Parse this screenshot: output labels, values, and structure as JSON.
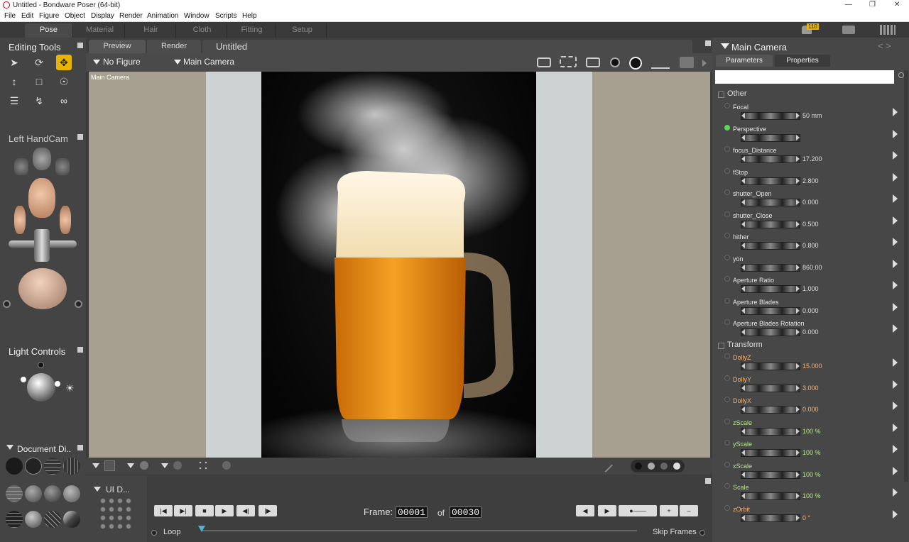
{
  "window": {
    "title": "Untitled - Bondware Poser (64-bit)"
  },
  "menu": [
    "File",
    "Edit",
    "Figure",
    "Object",
    "Display",
    "Render",
    "Animation",
    "Window",
    "Scripts",
    "Help"
  ],
  "rooms": [
    "Pose",
    "Material",
    "Hair",
    "Cloth",
    "Fitting",
    "Setup"
  ],
  "active_room": "Pose",
  "header_badge": "110",
  "editing_tools": {
    "title": "Editing Tools"
  },
  "handcam": {
    "title": "Left HandCam"
  },
  "light_controls": {
    "title": "Light Controls"
  },
  "document_display": {
    "title": "Document Di.."
  },
  "ui_dots": {
    "title": "UI D..."
  },
  "doc_tabs": {
    "preview": "Preview",
    "render": "Render",
    "doc_title": "Untitled"
  },
  "viewport": {
    "figure_select": "No Figure",
    "camera_select": "Main Camera",
    "camera_label": "Main Camera"
  },
  "timeline": {
    "frame_label": "Frame:",
    "current_frame": "00001",
    "of_label": "of",
    "total_frames": "00030",
    "loop_label": "Loop",
    "skip_frames_label": "Skip Frames"
  },
  "right_panel": {
    "title": "Main Camera",
    "tabs": [
      "Parameters",
      "Properties"
    ],
    "search_value": "",
    "groups": {
      "other": "Other",
      "transform": "Transform"
    },
    "params_other": [
      {
        "name": "Focal",
        "value": "50 mm",
        "style": ""
      },
      {
        "name": "Perspective",
        "value": "",
        "style": "",
        "radio_on": true
      },
      {
        "name": "focus_Distance",
        "value": "17.200",
        "style": ""
      },
      {
        "name": "fStop",
        "value": "2.800",
        "style": ""
      },
      {
        "name": "shutter_Open",
        "value": "0.000",
        "style": ""
      },
      {
        "name": "shutter_Close",
        "value": "0.500",
        "style": ""
      },
      {
        "name": "hither",
        "value": "0.800",
        "style": ""
      },
      {
        "name": "yon",
        "value": "860.00",
        "style": ""
      },
      {
        "name": "Aperture Ratio",
        "value": "1.000",
        "style": ""
      },
      {
        "name": "Aperture Blades",
        "value": "0.000",
        "style": ""
      },
      {
        "name": "Aperture Blades Rotation",
        "value": "0.000",
        "style": ""
      }
    ],
    "params_transform": [
      {
        "name": "DollyZ",
        "value": "15.000",
        "style": "orange"
      },
      {
        "name": "DollyY",
        "value": "3.000",
        "style": "orange"
      },
      {
        "name": "DollyX",
        "value": "0.000",
        "style": "orange"
      },
      {
        "name": "zScale",
        "value": "100 %",
        "style": "green"
      },
      {
        "name": "yScale",
        "value": "100 %",
        "style": "green"
      },
      {
        "name": "xScale",
        "value": "100 %",
        "style": "green"
      },
      {
        "name": "Scale",
        "value": "100 %",
        "style": "green"
      },
      {
        "name": "zOrbit",
        "value": "0 °",
        "style": "orange"
      }
    ]
  }
}
